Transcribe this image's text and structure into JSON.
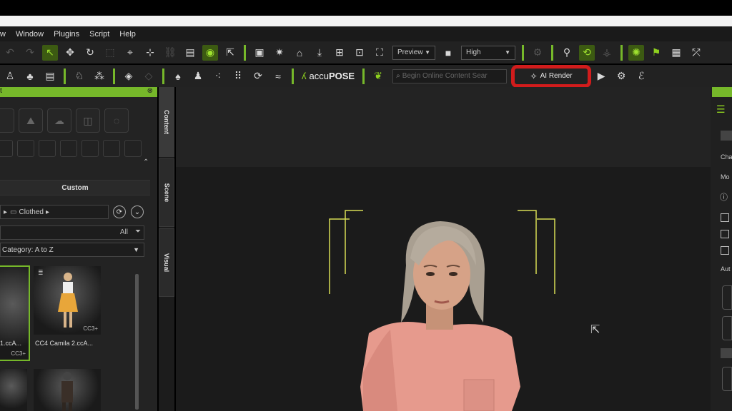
{
  "menu": [
    "w",
    "Window",
    "Plugins",
    "Script",
    "Help"
  ],
  "toolbar": {
    "preview_select": "Preview",
    "quality_select": "High",
    "accupose_prefix": "accu",
    "accupose_bold": "POSE",
    "search_placeholder": "Begin Online Content Sear",
    "ai_render_label": "AI Render"
  },
  "left_panel": {
    "title_fragment": "t",
    "section_title": "Custom",
    "breadcrumb": "Clothed",
    "filter_all": "All",
    "sort_label": "Category: A to Z",
    "items": [
      {
        "caption": "1.ccA...",
        "badge": "CC3+"
      },
      {
        "caption": "CC4 Camila 2.ccA...",
        "badge": "CC3+"
      }
    ]
  },
  "vertical_tabs": [
    "Content",
    "Scene",
    "Visual"
  ],
  "right_panel": {
    "labels": [
      "Cha",
      "Mo",
      "Aut"
    ]
  },
  "colors": {
    "accent_green": "#76b82a",
    "highlight_red": "#d11c1c"
  }
}
